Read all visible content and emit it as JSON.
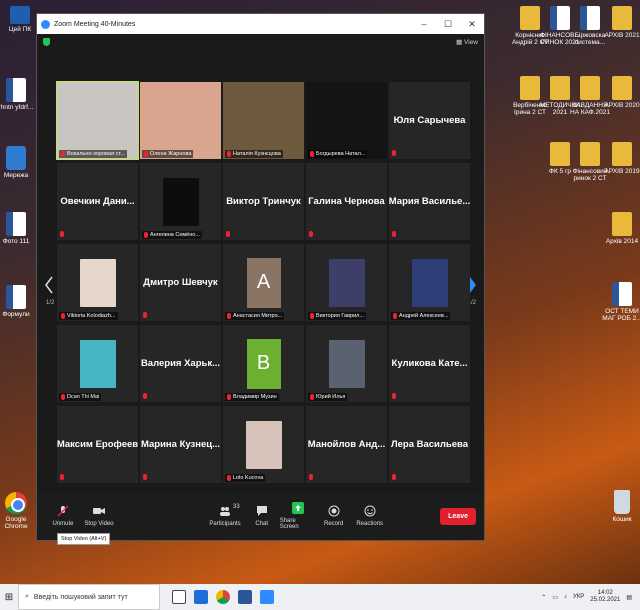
{
  "desktop": {
    "left_icons": [
      {
        "label": "Цей ПК",
        "type": "pc"
      },
      {
        "label": "rhntn yfdrf...",
        "type": "word"
      },
      {
        "label": "Мережа",
        "type": "net"
      },
      {
        "label": "Фото 111",
        "type": "word"
      },
      {
        "label": "Формули",
        "type": "word"
      },
      {
        "label": "Google Chrome",
        "type": "chrome"
      }
    ],
    "right_icons": [
      {
        "label": "Корнієнко Андрій 2 СТ",
        "type": "folder"
      },
      {
        "label": "ФІНАНСОВ... РИНОК 2021",
        "type": "word"
      },
      {
        "label": "Біржовска система...",
        "type": "word"
      },
      {
        "label": "АРХІВ 2021",
        "type": "folder"
      },
      {
        "label": "Вербіченко Ірина 2 СТ",
        "type": "folder"
      },
      {
        "label": "МЕТОДИЧКИ 2021",
        "type": "folder"
      },
      {
        "label": "ЗАВДАННЯ НА КАФ.2021",
        "type": "folder"
      },
      {
        "label": "АРХІВ 2020",
        "type": "folder"
      },
      {
        "label": "ФК 5 гр",
        "type": "folder"
      },
      {
        "label": "Фінансовий ринок 2 СТ",
        "type": "folder"
      },
      {
        "label": "АРХІВ 2019",
        "type": "folder"
      },
      {
        "label": "Архів 2014",
        "type": "folder"
      },
      {
        "label": "ОСТ ТЕМИ МАГ РОБ 2...",
        "type": "word"
      },
      {
        "label": "Кошик",
        "type": "bin"
      }
    ]
  },
  "zoom": {
    "title": "Zoom Meeting 40-Minutes",
    "view_label": "View",
    "page_left": "1/2",
    "page_right": "1/2",
    "tiles": [
      {
        "kind": "video",
        "caption": "Вокально-хоровая ст...",
        "color": "#c9c6c2",
        "active": true
      },
      {
        "kind": "video",
        "caption": "Олена Жарнова",
        "color": "#d9a58e"
      },
      {
        "kind": "video",
        "caption": "Наталія Кузнєцова",
        "color": "#6d5a3c"
      },
      {
        "kind": "video",
        "caption": "Богдырева Натал...",
        "color": "#141414"
      },
      {
        "kind": "name",
        "name": "Юля Сарычева"
      },
      {
        "kind": "name",
        "name": "Овечкин Дани..."
      },
      {
        "kind": "photo",
        "caption": "Ангелина Семёно...",
        "color": "#0d0d0d"
      },
      {
        "kind": "name",
        "name": "Виктор Тринчук"
      },
      {
        "kind": "name",
        "name": "Галина Чернова"
      },
      {
        "kind": "name",
        "name": "Мария Василье..."
      },
      {
        "kind": "photo",
        "caption": "Viktoria Kolodiazh...",
        "color": "#e7d7cb"
      },
      {
        "kind": "name",
        "name": "Дмитро Шевчук"
      },
      {
        "kind": "letter",
        "letter": "A",
        "caption": "Анастасия Митро...",
        "color": "#8a7464"
      },
      {
        "kind": "photo",
        "caption": "Виктория Гаврил...",
        "color": "#3d3f6a"
      },
      {
        "kind": "photo",
        "caption": "Андрей Алексеев...",
        "color": "#2e3f78"
      },
      {
        "kind": "photo",
        "caption": "Dcan Thi Mai",
        "color": "#45b7c4"
      },
      {
        "kind": "name",
        "name": "Валерия Харьк..."
      },
      {
        "kind": "letter",
        "letter": "В",
        "caption": "Владимир Музин",
        "color": "#6bb12f"
      },
      {
        "kind": "photo",
        "caption": "Юрий Илья",
        "color": "#5a6170"
      },
      {
        "kind": "name",
        "name": "Куликова Кате..."
      },
      {
        "kind": "name",
        "name": "Максим Ерофеев"
      },
      {
        "kind": "name",
        "name": "Марина Кузнец..."
      },
      {
        "kind": "photo",
        "caption": "Lolo Kucova",
        "color": "#d8c3bb"
      },
      {
        "kind": "name",
        "name": "Манойлов Анд..."
      },
      {
        "kind": "name",
        "name": "Лера Васильева"
      }
    ],
    "toolbar": {
      "unmute": "Unmute",
      "stop_video": "Stop Video",
      "participants": "Participants",
      "participants_count": "33",
      "chat": "Chat",
      "share_screen": "Share Screen",
      "record": "Record",
      "reactions": "Reactions",
      "leave": "Leave",
      "tooltip": "Stop Video (Alt+V)"
    },
    "colors": {
      "accent": "#2d8cff",
      "active_outline": "#c5e35a",
      "leave": "#e0202f",
      "share": "#23c552"
    }
  },
  "taskbar": {
    "search_placeholder": "Введіть пошуковий запит тут",
    "language": "УКР",
    "time": "14:02",
    "date": "25.02.2021"
  }
}
